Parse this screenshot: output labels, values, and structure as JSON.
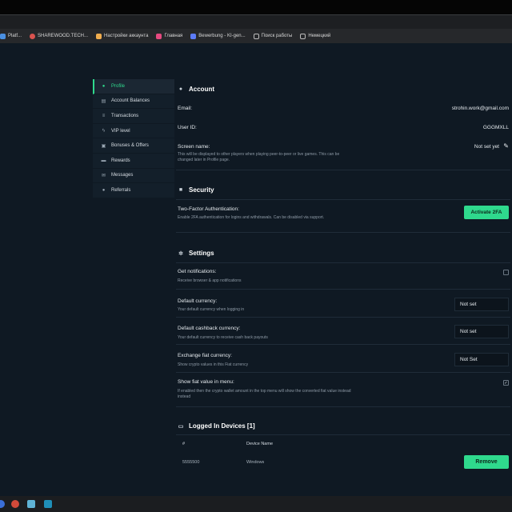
{
  "bookmarks": [
    {
      "label": "Platf...",
      "color": "#4a90e2"
    },
    {
      "label": "SHAREWOOD.TECH...",
      "color": "#d9534f"
    },
    {
      "label": "Настройки аккаунта",
      "color": "#f0ad4e"
    },
    {
      "label": "Главная",
      "color": "#e64980"
    },
    {
      "label": "Bewerbung - KI-gen...",
      "color": "#5c7cfa"
    },
    {
      "label": "Поиск работы",
      "color": "#888888"
    },
    {
      "label": "Немецкий",
      "color": "#888888"
    }
  ],
  "sidebar": {
    "items": [
      {
        "label": "Profile",
        "icon": "user-icon",
        "glyph": "●"
      },
      {
        "label": "Account Balances",
        "icon": "wallet-icon",
        "glyph": "▤"
      },
      {
        "label": "Transactions",
        "icon": "transactions-icon",
        "glyph": "≡"
      },
      {
        "label": "VIP level",
        "icon": "bolt-icon",
        "glyph": "ϟ"
      },
      {
        "label": "Bonuses & Offers",
        "icon": "gift-icon",
        "glyph": "▣"
      },
      {
        "label": "Rewards",
        "icon": "rewards-icon",
        "glyph": "▬"
      },
      {
        "label": "Messages",
        "icon": "mail-icon",
        "glyph": "✉"
      },
      {
        "label": "Referrals",
        "icon": "referrals-icon",
        "glyph": "●"
      }
    ]
  },
  "account": {
    "title": "Account",
    "email_label": "Email:",
    "email_value": "strohin.work@gmail.com",
    "userid_label": "User ID:",
    "userid_value": "GGGMXLL",
    "screen_name_label": "Screen name:",
    "screen_name_value": "Not set yet",
    "screen_name_desc": "This will be displayed to other players when playing peer-to-peer or live games. This can be changed later in Profile page."
  },
  "security": {
    "title": "Security",
    "twofa_label": "Two-Factor Authentication:",
    "twofa_desc": "Enable 2FA authentication for logins and withdrawals. Can be disabled via support.",
    "twofa_button": "Activate 2FA"
  },
  "settings": {
    "title": "Settings",
    "notifications_label": "Get notifications:",
    "notifications_desc": "Receive browser & app notifications",
    "currency_label": "Default currency:",
    "currency_desc": "Your default currency when logging in",
    "currency_value": "Not set",
    "cashback_label": "Default cashback currency:",
    "cashback_desc": "Your default currency to receive cash back payouts",
    "cashback_value": "Not set",
    "fiat_label": "Exchange fiat currency:",
    "fiat_desc": "Show crypto values in this Fiat currency",
    "fiat_value": "Not Set",
    "showfiat_label": "Show fiat value in menu:",
    "showfiat_desc": "If enabled then the crypto wallet amount in the top menu will show the converted fiat value instead instead"
  },
  "devices": {
    "title": "Logged In Devices [1]",
    "col_num": "#",
    "col_name": "Device Name",
    "rows": [
      {
        "id": "5555500",
        "name": "Windows",
        "action": "Remove"
      }
    ]
  },
  "colors": {
    "accent": "#2fd98d",
    "background": "#0f1923"
  }
}
